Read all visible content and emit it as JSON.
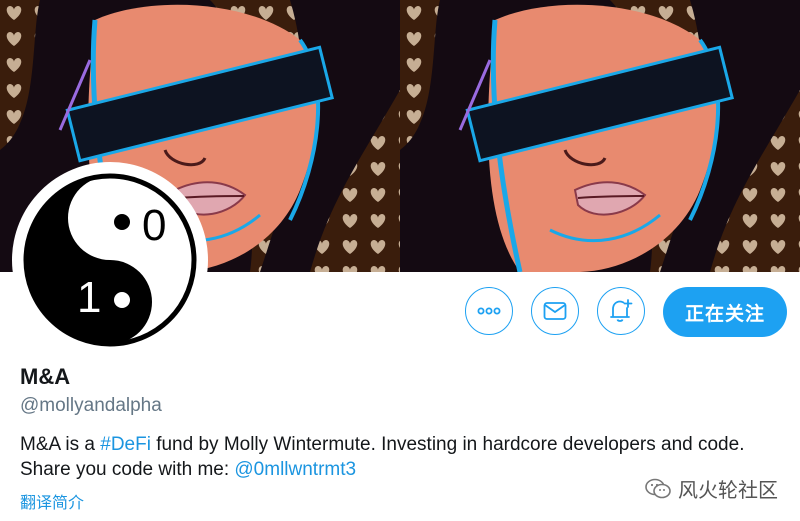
{
  "profile": {
    "display_name": "M&A",
    "handle": "@mollyandalpha",
    "bio": {
      "text_1": "M&A is a ",
      "hashtag": "#DeFi",
      "text_2": " fund by Molly Wintermute. Investing in hardcore developers and code. Share you code with me: ",
      "mention": "@0mllwntrmt3"
    },
    "translate_label": "翻译简介",
    "avatar_text": {
      "top": "0",
      "bottom": "1"
    }
  },
  "actions": {
    "more_icon": "more-icon",
    "message_icon": "mail-icon",
    "notify_icon": "bell-plus-icon",
    "following_label": "正在关注"
  },
  "watermark": {
    "label": "风火轮社区",
    "icon": "wechat-icon"
  },
  "colors": {
    "accent": "#1da1f2",
    "link": "#1b95e0",
    "secondary_text": "#657786",
    "primary_text": "#14171a"
  }
}
